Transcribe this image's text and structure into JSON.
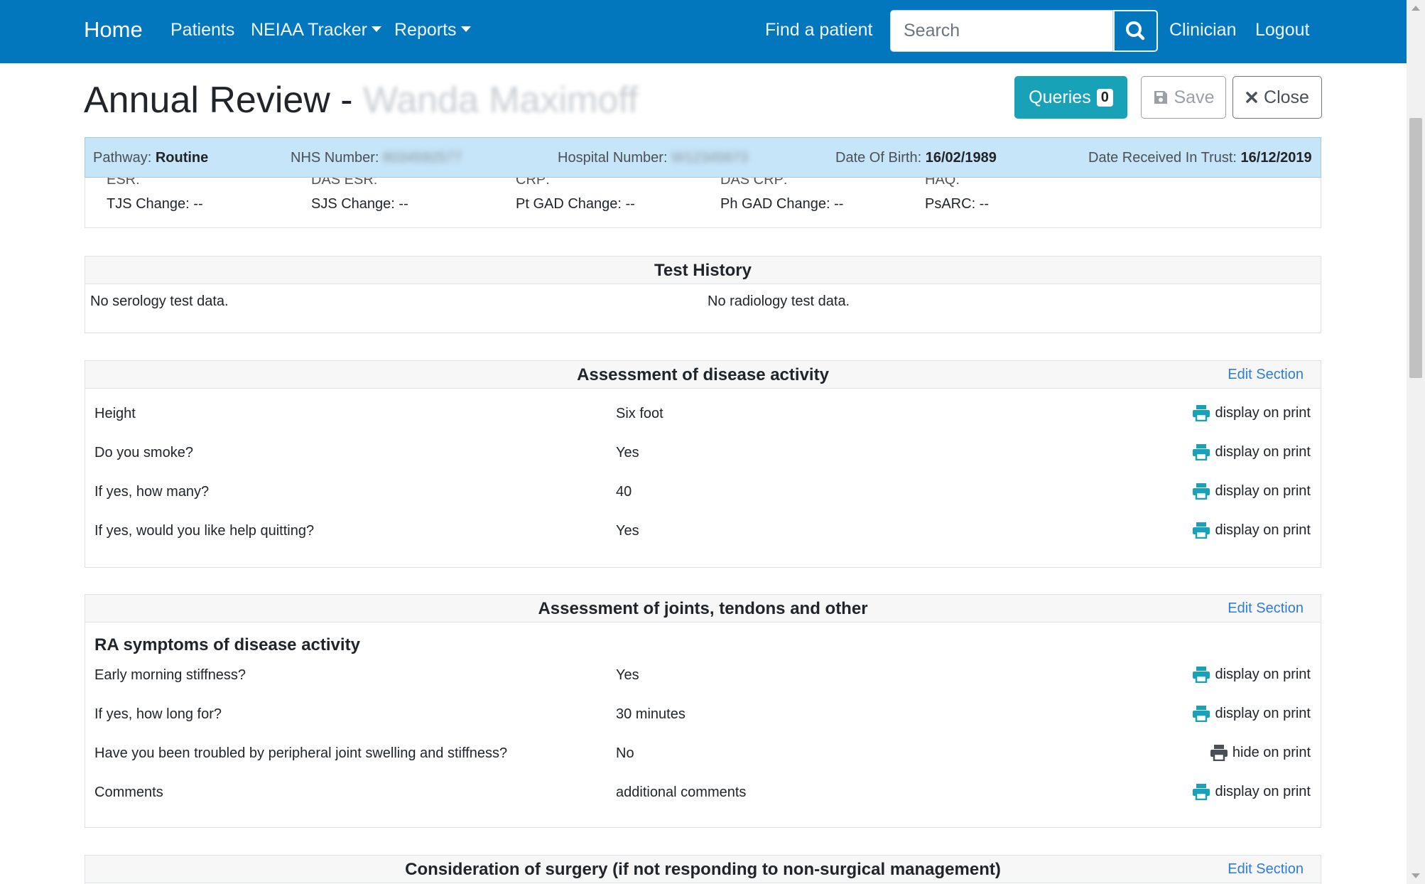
{
  "navbar": {
    "brand": "Home",
    "patients": "Patients",
    "tracker": "NEIAA Tracker",
    "reports": "Reports",
    "find": "Find a patient",
    "search_placeholder": "Search",
    "clinician": "Clinician",
    "logout": "Logout"
  },
  "header": {
    "title": "Annual Review -",
    "patient_name": "Wanda Maximoff",
    "queries_label": "Queries",
    "queries_count": "0",
    "save_label": "Save",
    "close_label": "Close"
  },
  "info": {
    "pathway_label": "Pathway:",
    "pathway_value": "Routine",
    "nhs_label": "NHS Number:",
    "nhs_value": "8034592577",
    "hospital_label": "Hospital Number:",
    "hospital_value": "W12345673",
    "dob_label": "Date Of Birth:",
    "dob_value": "16/02/1989",
    "received_label": "Date Received In Trust:",
    "received_value": "16/12/2019"
  },
  "scores": {
    "cut": [
      "ESR:",
      "DAS ESR:",
      "CRP:",
      "DAS CRP:",
      "HAQ:"
    ],
    "tjs": "TJS Change: --",
    "sjs": "SJS Change: --",
    "pt_gad": "Pt GAD Change: --",
    "ph_gad": "Ph GAD Change: --",
    "psarc": "PsARC: --"
  },
  "test_history": {
    "title": "Test History",
    "serology": "No serology test data.",
    "radiology": "No radiology test data."
  },
  "disease_activity": {
    "title": "Assessment of disease activity",
    "edit": "Edit Section",
    "rows": [
      {
        "q": "Height",
        "a": "Six foot",
        "print": "display on print"
      },
      {
        "q": "Do you smoke?",
        "a": "Yes",
        "print": "display on print"
      },
      {
        "q": "If yes, how many?",
        "a": "40",
        "print": "display on print"
      },
      {
        "q": "If yes, would you like help quitting?",
        "a": "Yes",
        "print": "display on print"
      }
    ]
  },
  "joints": {
    "title": "Assessment of joints, tendons and other",
    "edit": "Edit Section",
    "subheading": "RA symptoms of disease activity",
    "rows": [
      {
        "q": "Early morning stiffness?",
        "a": "Yes",
        "print": "display on print"
      },
      {
        "q": "If yes, how long for?",
        "a": "30 minutes",
        "print": "display on print"
      },
      {
        "q": "Have you been troubled by peripheral joint swelling and stiffness?",
        "a": "No",
        "print": "hide on print"
      },
      {
        "q": "Comments",
        "a": "additional comments",
        "print": "display on print"
      }
    ]
  },
  "surgery": {
    "title": "Consideration of surgery (if not responding to non-surgical management)",
    "edit": "Edit Section"
  },
  "colors": {
    "navbar": "#0277bd",
    "info_bar": "#c7e5f8",
    "queries": "#17a2b8",
    "print_active": "#17a2b8",
    "print_hidden": "#495057",
    "link": "#2b7dd8"
  }
}
